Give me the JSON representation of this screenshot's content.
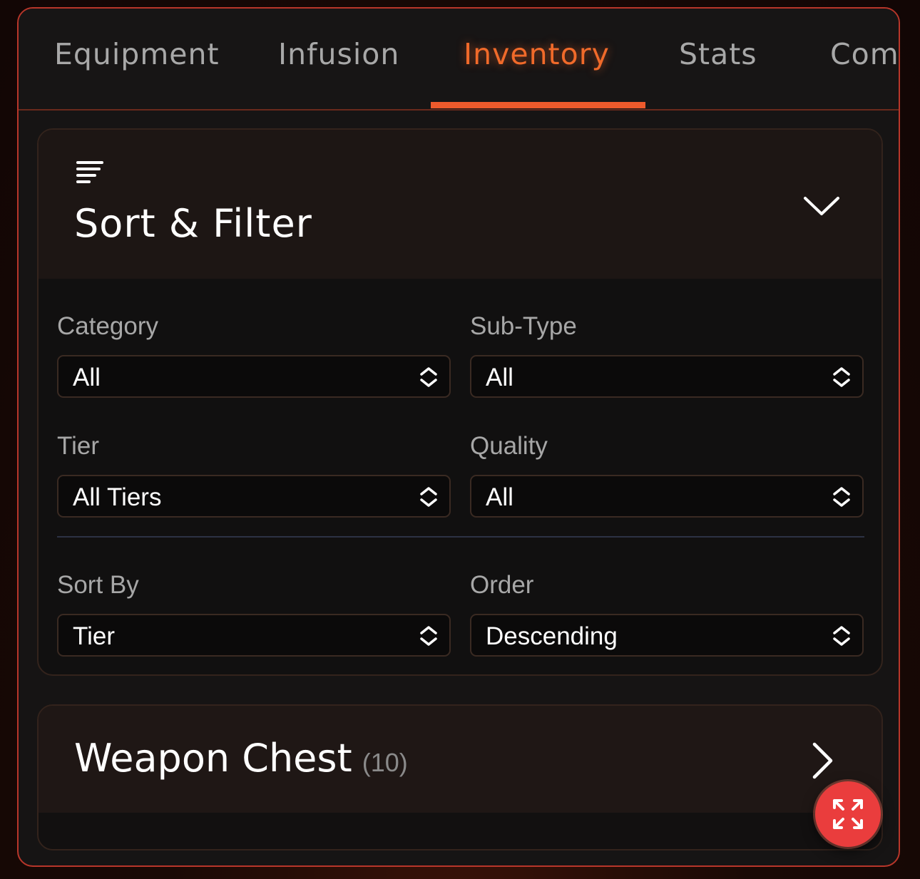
{
  "tabs": [
    {
      "label": "Equipment",
      "active": false
    },
    {
      "label": "Infusion",
      "active": false
    },
    {
      "label": "Inventory",
      "active": true
    },
    {
      "label": "Stats",
      "active": false
    },
    {
      "label": "Comb",
      "active": false
    }
  ],
  "sort_filter": {
    "title": "Sort & Filter",
    "icon": "filter-lines-icon",
    "collapse_icon": "chevron-down-icon",
    "fields": {
      "category": {
        "label": "Category",
        "value": "All"
      },
      "subtype": {
        "label": "Sub-Type",
        "value": "All"
      },
      "tier": {
        "label": "Tier",
        "value": "All Tiers"
      },
      "quality": {
        "label": "Quality",
        "value": "All"
      },
      "sort_by": {
        "label": "Sort By",
        "value": "Tier"
      },
      "order": {
        "label": "Order",
        "value": "Descending"
      }
    }
  },
  "weapon_chest": {
    "title": "Weapon Chest",
    "count": "(10)",
    "expand_icon": "chevron-right-icon"
  },
  "fab": {
    "icon": "expand-arrows-icon"
  },
  "colors": {
    "accent": "#ee5a2c",
    "panel_border": "#b8362a",
    "fab": "#ea3d3d",
    "tab_inactive": "#a8a8a8"
  }
}
